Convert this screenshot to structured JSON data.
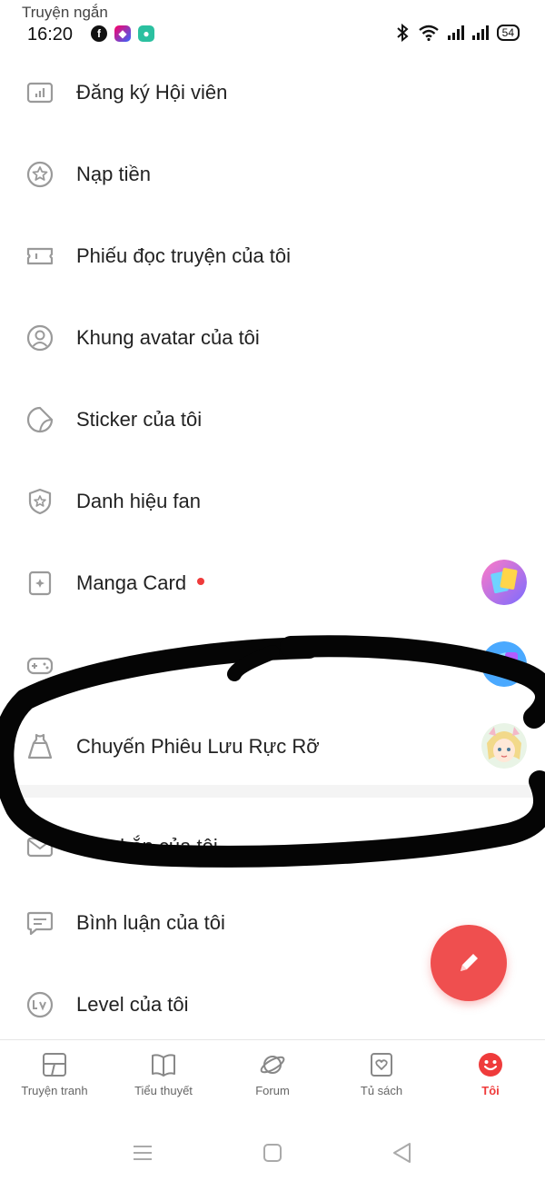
{
  "status_bar": {
    "app_name": "Truyện ngắn",
    "time": "16:20",
    "battery": "54",
    "notification_icons": [
      "facebook-icon",
      "shortcut-app-icon",
      "chat-app-icon"
    ],
    "system_icons": [
      "bluetooth-icon",
      "wifi-icon",
      "signal-icon",
      "signal-icon",
      "battery-icon"
    ]
  },
  "menu": {
    "items": [
      {
        "label": "Đăng ký Hội viên",
        "icon": "membership-chart-icon"
      },
      {
        "label": "Nạp tiền",
        "icon": "star-coin-icon"
      },
      {
        "label": "Phiếu đọc truyện của tôi",
        "icon": "ticket-icon"
      },
      {
        "label": "Khung avatar của tôi",
        "icon": "avatar-frame-icon"
      },
      {
        "label": "Sticker của tôi",
        "icon": "sticker-icon"
      },
      {
        "label": "Danh hiệu fan",
        "icon": "fan-badge-icon"
      },
      {
        "label": "Manga Card",
        "icon": "card-icon",
        "has_dot": true
      },
      {
        "label": "",
        "icon": "gamepad-icon",
        "obscured": true
      },
      {
        "label": "Chuyến Phiêu Lưu Rực Rỡ",
        "icon": "dress-icon"
      },
      {
        "label": "Tin nhắn của tôi",
        "icon": "message-icon",
        "obscured": true
      },
      {
        "label": "Bình luận của tôi",
        "icon": "comment-icon"
      },
      {
        "label": "Level của tôi",
        "icon": "level-icon"
      }
    ]
  },
  "fab": {
    "icon": "pencil-icon"
  },
  "tabs": [
    {
      "label": "Truyện tranh",
      "icon": "comic-icon",
      "active": false
    },
    {
      "label": "Tiểu thuyết",
      "icon": "book-icon",
      "active": false
    },
    {
      "label": "Forum",
      "icon": "planet-icon",
      "active": false
    },
    {
      "label": "Tủ sách",
      "icon": "bookshelf-heart-icon",
      "active": false
    },
    {
      "label": "Tôi",
      "icon": "smiley-icon",
      "active": true
    }
  ],
  "colors": {
    "accent": "#ef3b3b",
    "fab": "#ef4f4f",
    "icon_gray": "#9a9a9a",
    "text": "#222222"
  }
}
